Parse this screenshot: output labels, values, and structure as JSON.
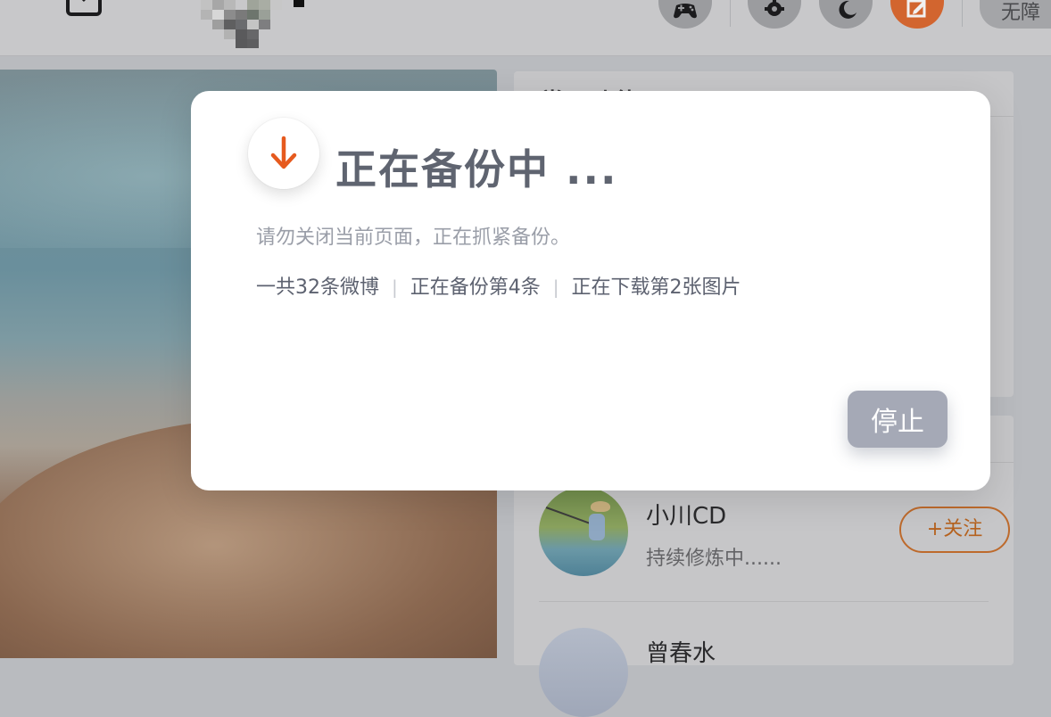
{
  "header": {
    "accessibility_label": "无障"
  },
  "sidebar_card": {
    "title": "常用功能"
  },
  "recommend": {
    "users": [
      {
        "name": "小川CD",
        "bio": "持续修炼中......",
        "follow_label": "+关注"
      },
      {
        "name": "曾春水"
      }
    ]
  },
  "modal": {
    "title": "正在备份中 ...",
    "subtitle": "请勿关闭当前页面，正在抓紧备份。",
    "stats": {
      "total": "一共32条微博",
      "current_post": "正在备份第4条",
      "current_image": "正在下载第2张图片"
    },
    "stop_label": "停止",
    "icon": "download-arrow-icon",
    "accent_color": "#e65a1e"
  },
  "colors": {
    "brand_orange": "#e2671f",
    "overlay_grey": "#b9bbbf"
  }
}
